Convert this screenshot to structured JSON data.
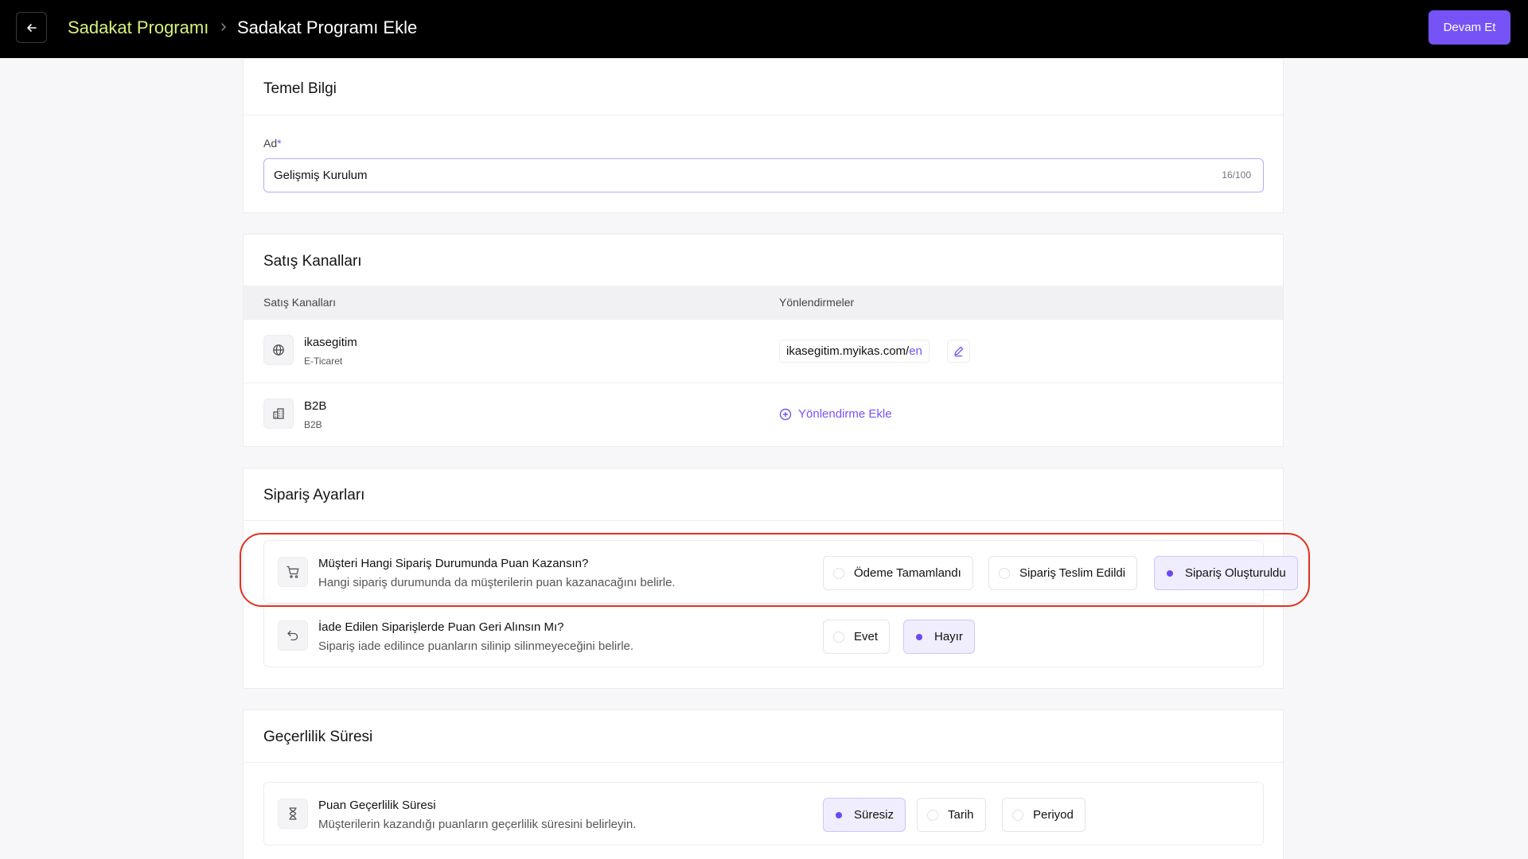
{
  "header": {
    "breadcrumb_parent": "Sadakat Programı",
    "breadcrumb_current": "Sadakat Programı Ekle",
    "continue_label": "Devam Et"
  },
  "basic_info": {
    "title": "Temel Bilgi",
    "name_label": "Ad",
    "required_mark": "*",
    "name_value": "Gelişmiş Kurulum",
    "char_count": "16/100"
  },
  "sales_channels": {
    "title": "Satış Kanalları",
    "col_channels": "Satış Kanalları",
    "col_redirects": "Yönlendirmeler",
    "rows": [
      {
        "name": "ikasegitim",
        "type": "E-Ticaret",
        "url": "ikasegitim.myikas.com/",
        "lang": "en",
        "icon": "globe-icon"
      },
      {
        "name": "B2B",
        "type": "B2B",
        "add_redirect_label": "Yönlendirme Ekle",
        "icon": "building-icon"
      }
    ]
  },
  "order_settings": {
    "title": "Sipariş Ayarları",
    "items": [
      {
        "title": "Müşteri Hangi Sipariş Durumunda Puan Kazansın?",
        "desc": "Hangi sipariş durumunda da müşterilerin puan kazanacağını belirle.",
        "icon": "cart-icon",
        "options": [
          "Ödeme Tamamlandı",
          "Sipariş Teslim Edildi",
          "Sipariş Oluşturuldu"
        ],
        "selected": "Sipariş Oluşturuldu"
      },
      {
        "title": "İade Edilen Siparişlerde Puan Geri Alınsın Mı?",
        "desc": "Sipariş iade edilince puanların silinip silinmeyeceğini belirle.",
        "icon": "undo-icon",
        "options": [
          "Evet",
          "Hayır"
        ],
        "selected": "Hayır"
      }
    ]
  },
  "validity": {
    "title": "Geçerlilik Süresi",
    "item": {
      "title": "Puan Geçerlilik Süresi",
      "desc": "Müşterilerin kazandığı puanların geçerlilik süresini belirleyin.",
      "icon": "hourglass-icon",
      "options": [
        "Süresiz",
        "Tarih",
        "Periyod"
      ],
      "selected": "Süresiz"
    }
  },
  "colors": {
    "accent": "#7653f7",
    "breadcrumb_parent": "#d9f27a",
    "highlight": "#e2311f"
  }
}
